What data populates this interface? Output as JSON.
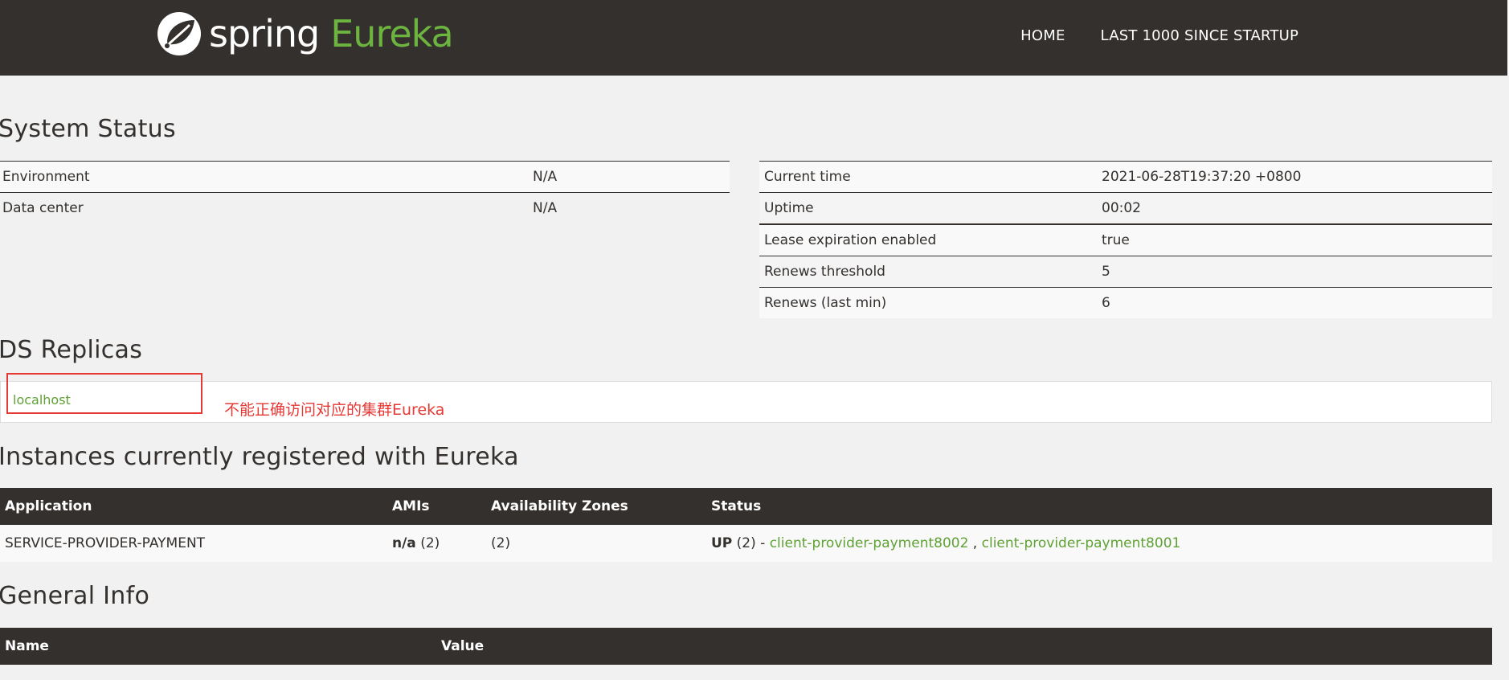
{
  "header": {
    "logo_spring": "spring",
    "logo_eureka": "Eureka",
    "nav": [
      "HOME",
      "LAST 1000 SINCE STARTUP"
    ]
  },
  "system_status": {
    "title": "System Status",
    "left": [
      {
        "label": "Environment",
        "value": "N/A"
      },
      {
        "label": "Data center",
        "value": "N/A"
      }
    ],
    "right": [
      {
        "label": "Current time",
        "value": "2021-06-28T19:37:20 +0800"
      },
      {
        "label": "Uptime",
        "value": "00:02"
      },
      {
        "label": "Lease expiration enabled",
        "value": "true"
      },
      {
        "label": "Renews threshold",
        "value": "5"
      },
      {
        "label": "Renews (last min)",
        "value": "6"
      }
    ]
  },
  "replicas": {
    "title": "DS Replicas",
    "link": "localhost",
    "annotation": "不能正确访问对应的集群Eureka"
  },
  "instances": {
    "title": "Instances currently registered with Eureka",
    "headers": [
      "Application",
      "AMIs",
      "Availability Zones",
      "Status"
    ],
    "rows": [
      {
        "application": "SERVICE-PROVIDER-PAYMENT",
        "ami_bold": "n/a",
        "ami_count": " (2)",
        "zones": "(2)",
        "status_bold": "UP",
        "status_count": " (2) - ",
        "link1": "client-provider-payment8002",
        "separator": " , ",
        "link2": "client-provider-payment8001"
      }
    ]
  },
  "general_info": {
    "title": "General Info",
    "headers": [
      "Name",
      "Value"
    ]
  },
  "colors": {
    "header_bg": "#34302d",
    "accent_green": "#6db33f",
    "annotation_red": "#e53935"
  }
}
